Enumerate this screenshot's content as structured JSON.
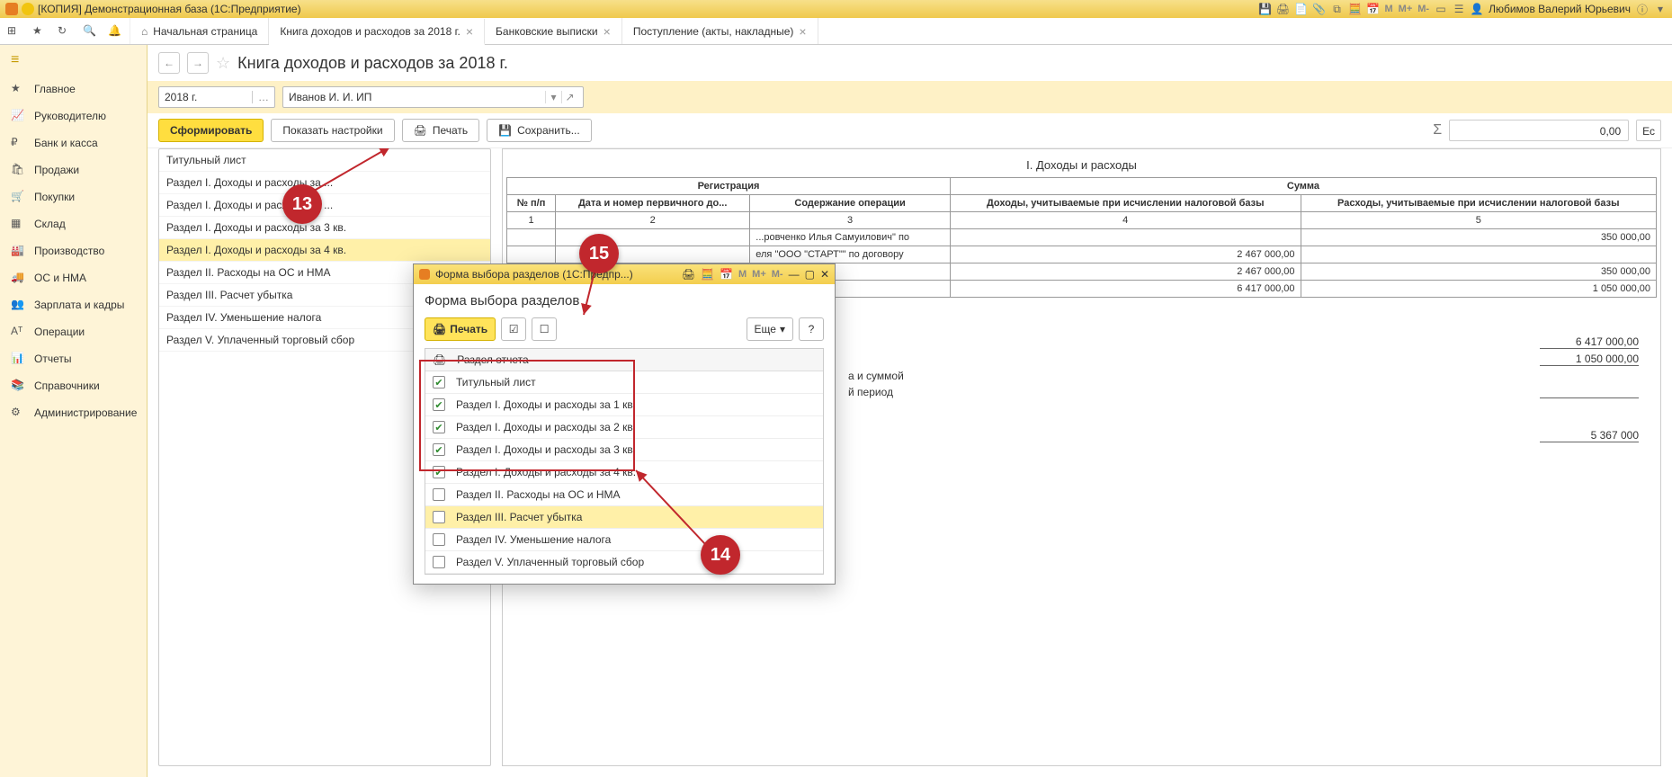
{
  "window_title": "[КОПИЯ] Демонстрационная база (1С:Предприятие)",
  "user_name": "Любимов Валерий Юрьевич",
  "top_m": [
    "M",
    "M+",
    "M-"
  ],
  "tool_icons": [
    "apps-icon",
    "star-icon",
    "history-icon",
    "search-icon",
    "bell-icon"
  ],
  "tabs": [
    {
      "label": "Начальная страница",
      "home": true,
      "closable": false
    },
    {
      "label": "Книга доходов и расходов за 2018 г.",
      "closable": true,
      "active": true
    },
    {
      "label": "Банковские выписки",
      "closable": true
    },
    {
      "label": "Поступление (акты, накладные)",
      "closable": true
    }
  ],
  "sidebar": [
    {
      "label": "Главное",
      "icon": "star"
    },
    {
      "label": "Руководителю",
      "icon": "trend"
    },
    {
      "label": "Банк и касса",
      "icon": "coin"
    },
    {
      "label": "Продажи",
      "icon": "bag"
    },
    {
      "label": "Покупки",
      "icon": "cart"
    },
    {
      "label": "Склад",
      "icon": "boxes"
    },
    {
      "label": "Производство",
      "icon": "factory"
    },
    {
      "label": "ОС и НМА",
      "icon": "truck"
    },
    {
      "label": "Зарплата и кадры",
      "icon": "people"
    },
    {
      "label": "Операции",
      "icon": "ops"
    },
    {
      "label": "Отчеты",
      "icon": "chart"
    },
    {
      "label": "Справочники",
      "icon": "book"
    },
    {
      "label": "Администрирование",
      "icon": "gear"
    }
  ],
  "page_title": "Книга доходов и расходов за 2018 г.",
  "filter": {
    "period": "2018 г.",
    "org": "Иванов И. И. ИП"
  },
  "actions": {
    "form": "Сформировать",
    "settings": "Показать настройки",
    "print": "Печать",
    "save": "Сохранить..."
  },
  "sum": {
    "value": "0,00",
    "eu": "Ес"
  },
  "navlist": [
    "Титульный лист",
    "Раздел I. Доходы и расходы за ...",
    "Раздел I. Доходы и расходы за ...",
    "Раздел I. Доходы и расходы за 3 кв.",
    "Раздел I. Доходы и расходы за 4 кв.",
    "Раздел II. Расходы на ОС и НМА",
    "Раздел III. Расчет убытка",
    "Раздел IV. Уменьшение налога",
    "Раздел V. Уплаченный торговый сбор"
  ],
  "navlist_selected": 4,
  "report": {
    "title": "I. Доходы и расходы",
    "headers": {
      "reg": "Регистрация",
      "sum": "Сумма",
      "npp": "№ п/п",
      "date": "Дата и номер первичного до...",
      "content": "Содержание операции",
      "income": "Доходы, учитываемые при исчислении налоговой базы",
      "expense": "Расходы, учитываемые при исчислении налоговой базы"
    },
    "colnums": [
      "1",
      "2",
      "3",
      "4",
      "5"
    ],
    "rows": [
      {
        "txt": "...ровченко Илья Самуилович\" по",
        "inc": "",
        "exp": "350 000,00"
      },
      {
        "txt": "еля \"ООО \"СТАРТ\"\" по договору",
        "inc": "2 467 000,00",
        "exp": ""
      },
      {
        "txt": "",
        "inc": "2 467 000,00",
        "exp": "350 000,00"
      },
      {
        "txt": "",
        "inc": "6 417 000,00",
        "exp": "1 050 000,00"
      }
    ],
    "totals": [
      {
        "a": "6 417 000,00",
        "b": ""
      },
      {
        "a": "1 050 000,00",
        "b": ""
      },
      {
        "a": "",
        "b": ""
      },
      {
        "a": "5 367 000",
        "b": ""
      }
    ],
    "total_labels": [
      "а и суммой",
      "й период"
    ]
  },
  "modal": {
    "wintitle": "Форма выбора разделов (1С:Предпр...)",
    "title": "Форма выбора разделов",
    "print": "Печать",
    "more": "Еще",
    "help": "?",
    "header": "Раздел отчета",
    "m_labels": [
      "M",
      "M+",
      "M-"
    ],
    "rows": [
      {
        "label": "Титульный лист",
        "checked": true
      },
      {
        "label": "Раздел I. Доходы и расходы за 1 кв.",
        "checked": true
      },
      {
        "label": "Раздел I. Доходы и расходы за 2 кв.",
        "checked": true
      },
      {
        "label": "Раздел I. Доходы и расходы за 3 кв.",
        "checked": true
      },
      {
        "label": "Раздел I. Доходы и расходы за 4 кв.",
        "checked": true
      },
      {
        "label": "Раздел II. Расходы на ОС и НМА",
        "checked": false
      },
      {
        "label": "Раздел III. Расчет убытка",
        "checked": false,
        "sel": true
      },
      {
        "label": "Раздел IV. Уменьшение налога",
        "checked": false
      },
      {
        "label": "Раздел V. Уплаченный торговый сбор",
        "checked": false
      }
    ]
  },
  "callouts": {
    "c13": "13",
    "c14": "14",
    "c15": "15"
  }
}
